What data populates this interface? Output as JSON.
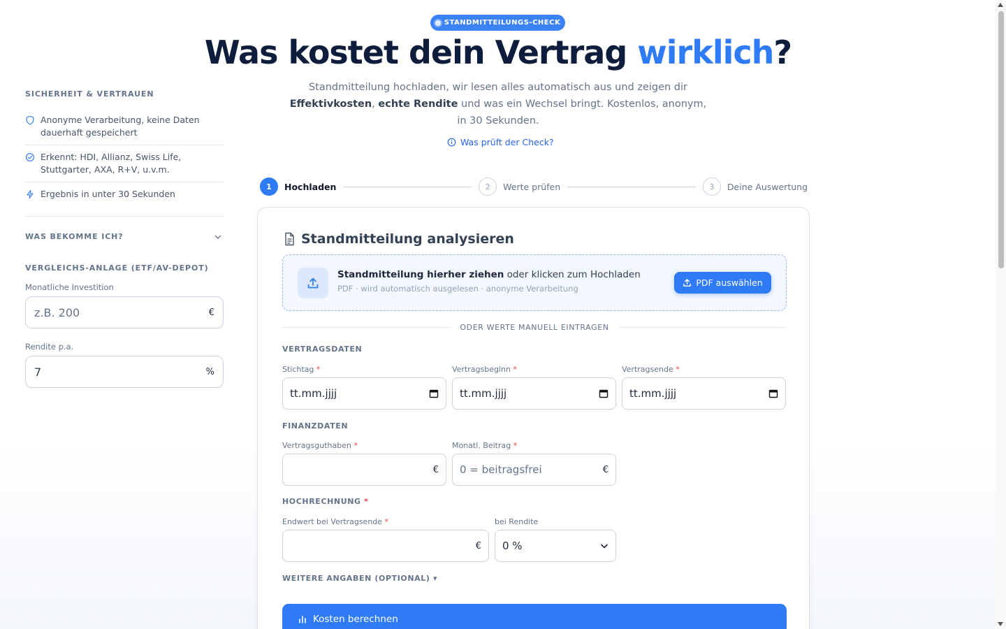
{
  "badge": "STANDMITTEILUNGS-CHECK",
  "hero": {
    "title_prefix": "Was kostet dein Vertrag ",
    "title_accent": "wirklich",
    "title_suffix": "?",
    "sub_1": "Standmitteilung hochladen, wir lesen alles automatisch aus und zeigen dir",
    "sub_b1": "Effektivkosten",
    "sub_sep": ", ",
    "sub_b2": "echte Rendite",
    "sub_2": " und was ein Wechsel bringt. Kostenlos, anonym, in 30 Sekunden.",
    "link": "Was prüft der Check?"
  },
  "sidebar": {
    "trust_title": "SICHERHEIT & VERTRAUEN",
    "trust_items": [
      {
        "icon": "shield-icon",
        "text": "Anonyme Verarbeitung, keine Daten dauerhaft gespeichert"
      },
      {
        "icon": "check-circle-icon",
        "text": "Erkennt: HDI, Allianz, Swiss Life, Stuttgarter, AXA, R+V, u.v.m."
      },
      {
        "icon": "lightning-icon",
        "text": "Ergebnis in unter 30 Sekunden"
      }
    ],
    "accordion_label": "WAS BEKOMME ICH?",
    "compare_title": "VERGLEICHS-ANLAGE (ETF/AV-DEPOT)",
    "monthly_label": "Monatliche Investition",
    "monthly_placeholder": "z.B. 200",
    "monthly_unit": "€",
    "return_label": "Rendite p.a.",
    "return_value": "7",
    "return_unit": "%"
  },
  "steps": [
    {
      "num": "1",
      "label": "Hochladen"
    },
    {
      "num": "2",
      "label": "Werte prüfen"
    },
    {
      "num": "3",
      "label": "Deine Auswertung"
    }
  ],
  "card": {
    "title": "Standmitteilung analysieren",
    "dz_bold": "Standmitteilung hierher ziehen",
    "dz_rest": " oder klicken zum Hochladen",
    "dz_sub": "PDF · wird automatisch ausgelesen · anonyme Verarbeitung",
    "pdf_button": "PDF auswählen",
    "or_text": "ODER WERTE MANUELL EINTRAGEN",
    "vertragsdaten": "VERTRAGSDATEN",
    "stichtag": "Stichtag",
    "vertragsbeginn": "Vertragsbeginn",
    "vertragsende": "Vertragsende",
    "date_placeholder": "tt.mm.jjjj",
    "finanzdaten": "FINANZDATEN",
    "guthaben": "Vertragsguthaben",
    "beitrag": "Monatl. Beitrag",
    "beitrag_placeholder": "0 = beitragsfrei",
    "euro": "€",
    "hochrechnung": "HOCHRECHNUNG",
    "endwert": "Endwert bei Vertragsende",
    "bei_rendite": "bei Rendite",
    "rendite_selected": "0 %",
    "weitere": "WEITERE ANGABEN (OPTIONAL) ▾",
    "calc_button": "Kosten berechnen",
    "required_mark": "*"
  }
}
